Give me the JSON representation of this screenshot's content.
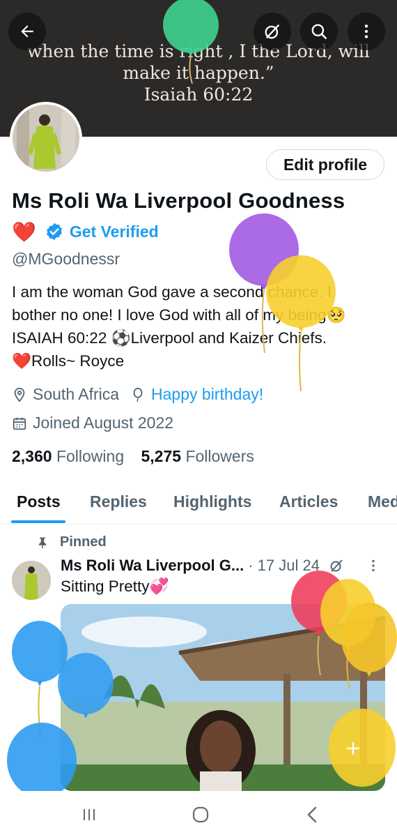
{
  "banner": {
    "quote_lines": [
      "when the time is right , I the Lord, will",
      "make it happen.”",
      "Isaiah 60:22"
    ]
  },
  "top_bar": {
    "back_icon": "arrow-left-icon",
    "grok_icon": "slashed-circle-icon",
    "search_icon": "search-icon",
    "more_icon": "vertical-dots-icon"
  },
  "profile": {
    "edit_button": "Edit profile",
    "display_name": "Ms Roli Wa Liverpool Goodness",
    "heart_emoji": "❤️",
    "verify_label": "Get Verified",
    "handle": "@MGoodnessr",
    "bio_lines": [
      "I am the woman God gave a second chance.  I",
      "bother no one! I love God with all of my being🥺",
      "ISAIAH 60:22  ⚽Liverpool and Kaizer Chiefs.",
      "❤️Rolls~ Royce"
    ],
    "location": "South Africa",
    "birthday_link": "Happy birthday!",
    "joined": "Joined August 2022",
    "following_count": "2,360",
    "following_label": "Following",
    "followers_count": "5,275",
    "followers_label": "Followers"
  },
  "tabs": [
    {
      "label": "Posts",
      "active": true
    },
    {
      "label": "Replies",
      "active": false
    },
    {
      "label": "Highlights",
      "active": false
    },
    {
      "label": "Articles",
      "active": false
    },
    {
      "label": "Media",
      "active": false
    }
  ],
  "pinned_post": {
    "pinned_label": "Pinned",
    "author": "Ms Roli Wa Liverpool G...",
    "date": "· 17 Jul 24",
    "text": "Sitting Pretty💞"
  },
  "colors": {
    "accent": "#1d9bf0",
    "secondary_text": "#536471",
    "primary_text": "#0f1419",
    "banner": "#2b2a28"
  }
}
